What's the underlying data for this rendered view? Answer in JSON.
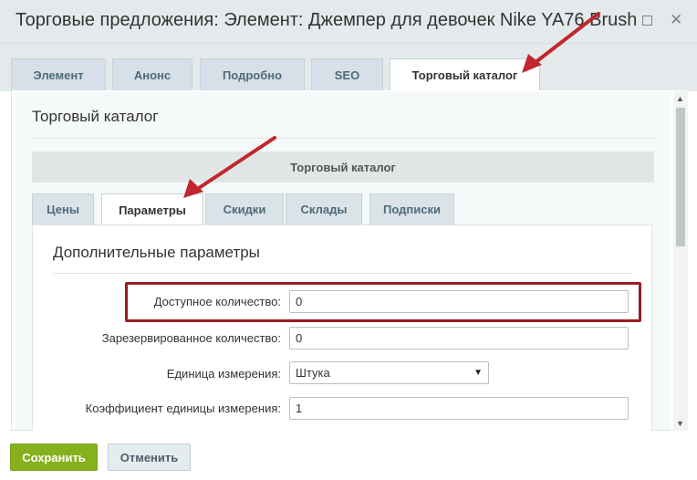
{
  "window": {
    "title": "Торговые предложения: Элемент: Джемпер для девочек Nike YA76 Brush",
    "minimize_icon": "minimize-icon",
    "close_icon": "close-icon"
  },
  "top_tabs": [
    {
      "label": "Элемент",
      "active": false
    },
    {
      "label": "Анонс",
      "active": false
    },
    {
      "label": "Подробно",
      "active": false
    },
    {
      "label": "SEO",
      "active": false
    },
    {
      "label": "Торговый каталог",
      "active": true
    }
  ],
  "section": {
    "title": "Торговый каталог",
    "sub_header": "Торговый каталог"
  },
  "sub_tabs": [
    {
      "label": "Цены",
      "active": false
    },
    {
      "label": "Параметры",
      "active": true
    },
    {
      "label": "Скидки",
      "active": false
    },
    {
      "label": "Склады",
      "active": false
    },
    {
      "label": "Подписки",
      "active": false
    }
  ],
  "params": {
    "title": "Дополнительные параметры",
    "available_qty": {
      "label": "Доступное количество:",
      "value": "0"
    },
    "reserved_qty": {
      "label": "Зарезервированное количество:",
      "value": "0"
    },
    "unit": {
      "label": "Единица измерения:",
      "value": "Штука"
    },
    "unit_ratio": {
      "label": "Коэффициент единицы измерения:",
      "value": "1"
    }
  },
  "footer": {
    "save_label": "Сохранить",
    "cancel_label": "Отменить"
  },
  "colors": {
    "save_button": "#86b11e",
    "highlight_box": "#9b1b25",
    "annotation_arrow": "#c1272d"
  }
}
